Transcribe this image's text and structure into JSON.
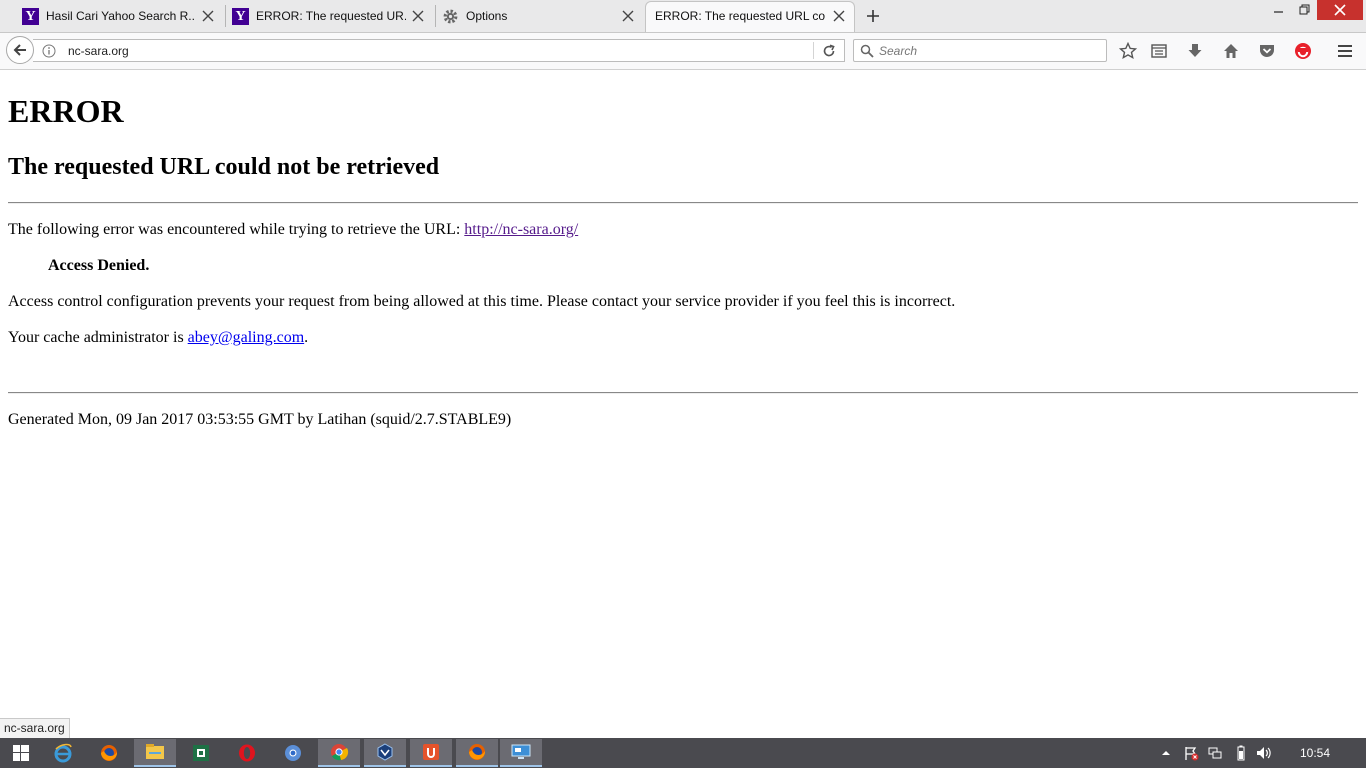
{
  "browser": {
    "tabs": [
      {
        "label": "Hasil Cari Yahoo Search R...",
        "icon": "yahoo-icon",
        "active": false
      },
      {
        "label": "ERROR: The requested UR...",
        "icon": "yahoo-icon",
        "active": false
      },
      {
        "label": "Options",
        "icon": "gear-icon",
        "active": false
      },
      {
        "label": "ERROR: The requested URL co...",
        "icon": "none",
        "active": true
      }
    ],
    "url": "nc-sara.org",
    "search_placeholder": "Search"
  },
  "page": {
    "title": "ERROR",
    "subtitle": "The requested URL could not be retrieved",
    "intro_text": "The following error was encountered while trying to retrieve the URL: ",
    "intro_link": "http://nc-sara.org/",
    "denied": "Access Denied.",
    "explanation": "Access control configuration prevents your request from being allowed at this time. Please contact your service provider if you feel this is incorrect.",
    "admin_prefix": "Your cache administrator is ",
    "admin_email": "abey@galing.com",
    "admin_suffix": ".",
    "footer": "Generated Mon, 09 Jan 2017 03:53:55 GMT by Latihan (squid/2.7.STABLE9)"
  },
  "status_bar": {
    "link_preview": "nc-sara.org"
  },
  "taskbar": {
    "items": [
      "start-icon",
      "ie-icon",
      "firefox-icon",
      "file-explorer-icon",
      "excel-icon",
      "opera-icon",
      "chromium-icon",
      "chrome-icon",
      "virtualbox-icon",
      "uc-browser-icon",
      "firefox-icon",
      "remote-desktop-icon"
    ],
    "clock": "10:54"
  },
  "colors": {
    "link": "#0000ee",
    "visited_link": "#551a8b",
    "yahoo": "#410093",
    "taskbar": "#4a4a4f"
  }
}
